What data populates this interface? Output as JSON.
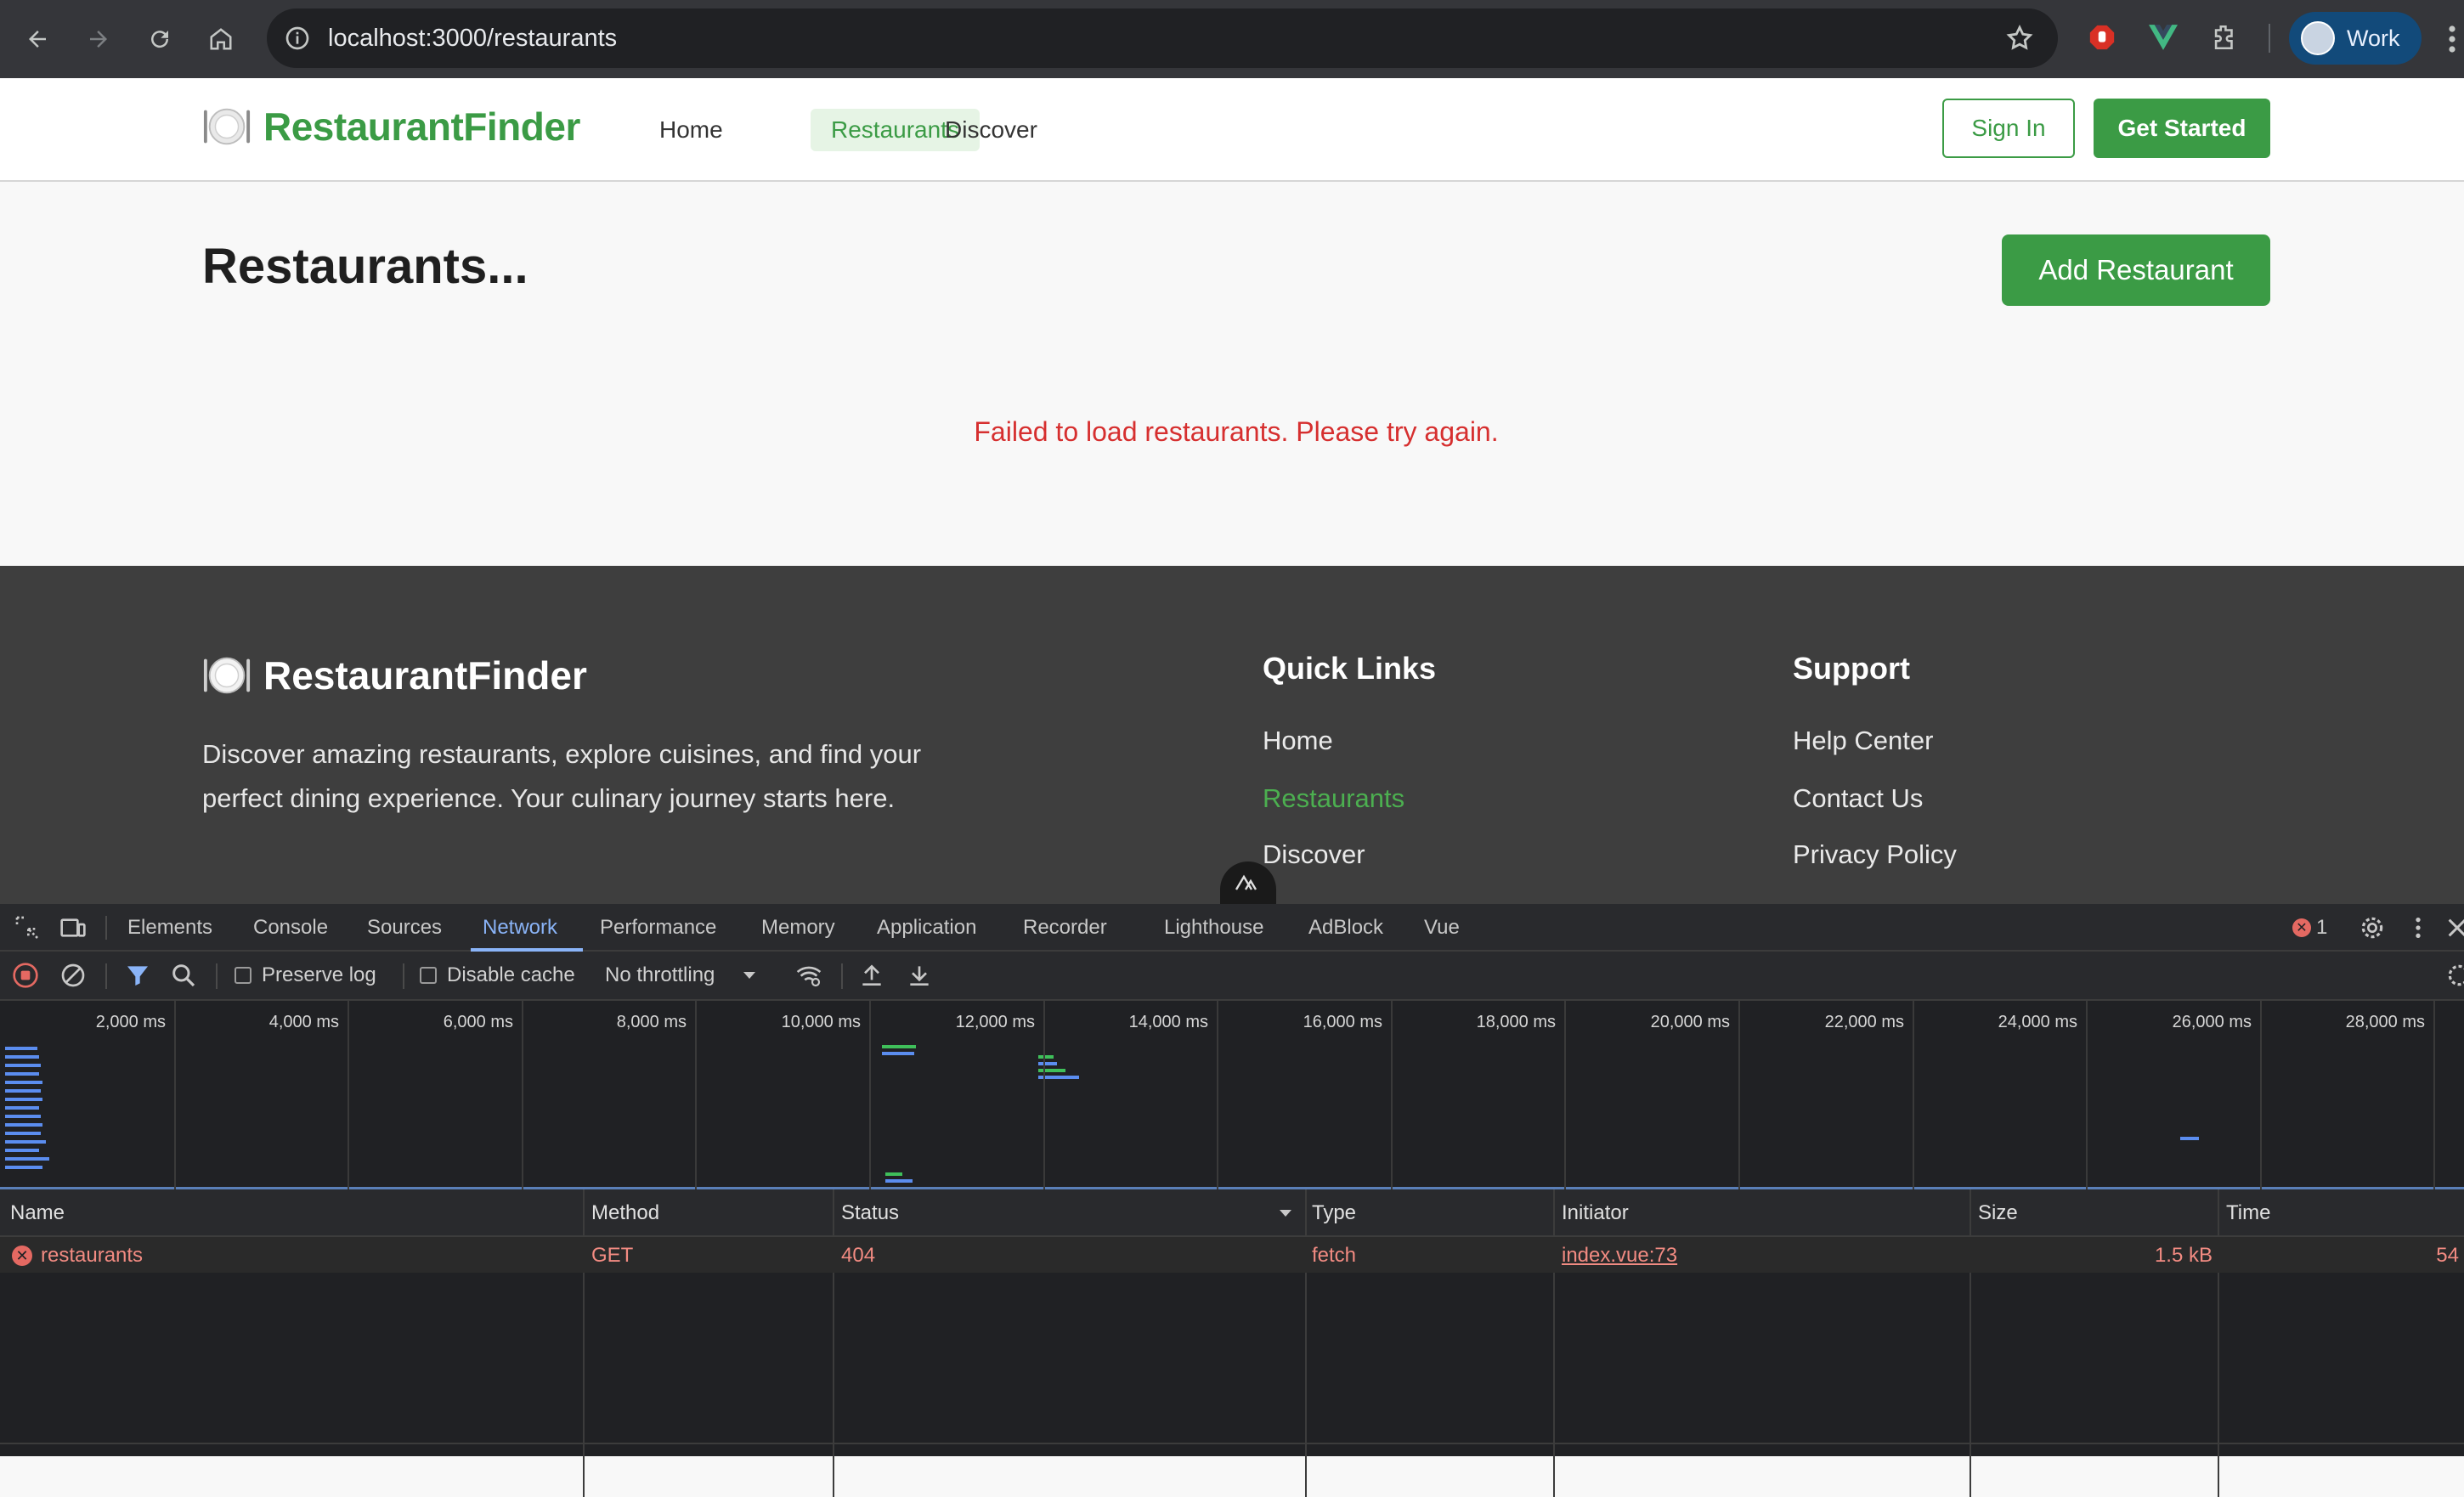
{
  "browser": {
    "url": "localhost:3000/restaurants",
    "profile_label": "Work"
  },
  "header": {
    "brand": "RestaurantFinder",
    "nav": [
      "Home",
      "Restaurants",
      "Discover"
    ],
    "active_nav": "Restaurants",
    "sign_in": "Sign In",
    "get_started": "Get Started"
  },
  "main": {
    "title": "Restaurants...",
    "add_button": "Add Restaurant",
    "error": "Failed to load restaurants. Please try again."
  },
  "footer": {
    "brand": "RestaurantFinder",
    "description": "Discover amazing restaurants, explore cuisines, and find your perfect dining experience. Your culinary journey starts here.",
    "quick_links_title": "Quick Links",
    "quick_links": [
      "Home",
      "Restaurants",
      "Discover"
    ],
    "support_title": "Support",
    "support_links": [
      "Help Center",
      "Contact Us",
      "Privacy Policy"
    ]
  },
  "devtools": {
    "tabs": [
      "Elements",
      "Console",
      "Sources",
      "Network",
      "Performance",
      "Memory",
      "Application",
      "Recorder",
      "Lighthouse",
      "AdBlock",
      "Vue"
    ],
    "active_tab": "Network",
    "error_count": "1",
    "toolbar": {
      "preserve_log": "Preserve log",
      "disable_cache": "Disable cache",
      "throttling": "No throttling"
    },
    "timeline_ticks": [
      "2,000 ms",
      "4,000 ms",
      "6,000 ms",
      "8,000 ms",
      "10,000 ms",
      "12,000 ms",
      "14,000 ms",
      "16,000 ms",
      "18,000 ms",
      "20,000 ms",
      "22,000 ms",
      "24,000 ms",
      "26,000 ms",
      "28,000 ms"
    ],
    "columns": [
      "Name",
      "Method",
      "Status",
      "Type",
      "Initiator",
      "Size",
      "Time"
    ],
    "requests": [
      {
        "name": "restaurants",
        "method": "GET",
        "status": "404",
        "type": "fetch",
        "initiator": "index.vue:73",
        "size": "1.5 kB",
        "time": "54"
      }
    ]
  },
  "colors": {
    "brand_green": "#3b9b45",
    "error_red": "#d62f2f",
    "footer_bg": "#3e3e3e",
    "devtools_accent": "#8ab4f8"
  }
}
